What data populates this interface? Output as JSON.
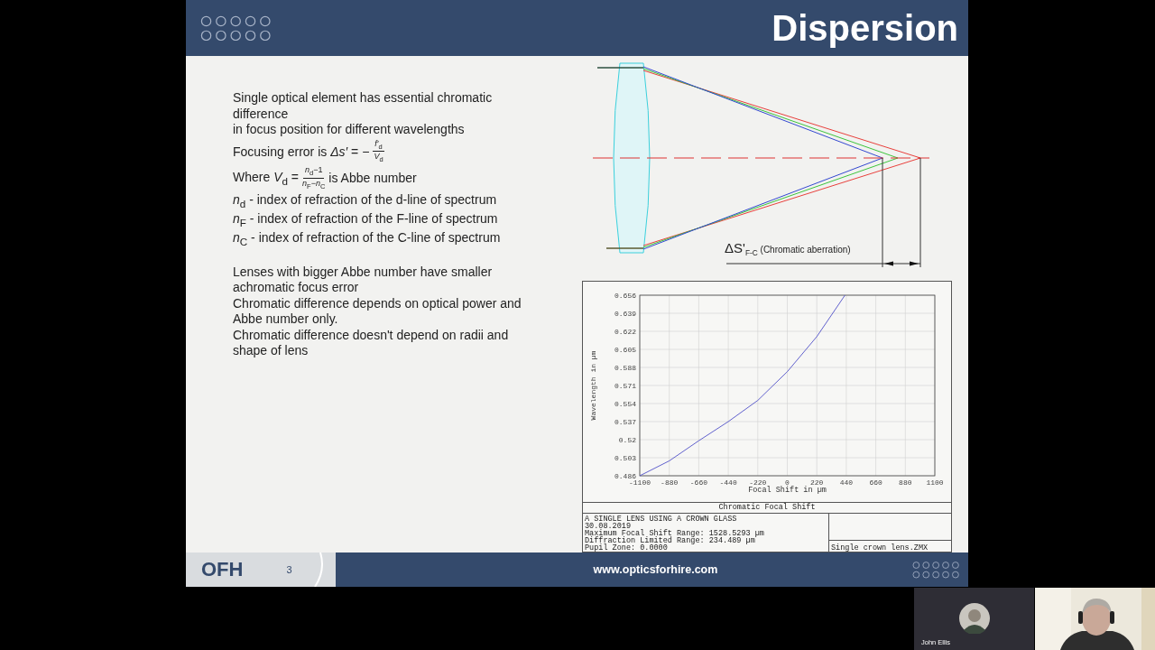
{
  "slide": {
    "title": "Dispersion",
    "body": [
      {
        "kind": "text",
        "text": "Single optical element has essential chromatic difference"
      },
      {
        "kind": "text",
        "text": "in focus position for different wavelengths"
      },
      {
        "kind": "formula",
        "lead": "Focusing error is *Δs′* = −",
        "numerator": "*f′*$_{d}$",
        "denominator": "*V*$_{d}$"
      },
      {
        "kind": "formula",
        "lead": "Where *V*$_{d}$ =",
        "numerator": "*n*$_{d}$−1",
        "denominator": "*n*$_{F}$−*n*$_{C}$",
        "tail": "is Abbe number"
      },
      {
        "kind": "text",
        "text": "*n*$_{d}$ - index of refraction of the d-line of spectrum"
      },
      {
        "kind": "text",
        "text": "*n*$_{F}$ - index of refraction of the F-line of spectrum"
      },
      {
        "kind": "text",
        "text": "*n*$_{C}$ - index of refraction of the C-line of spectrum"
      },
      {
        "kind": "spacer"
      },
      {
        "kind": "text",
        "text": "Lenses with bigger Abbe number have smaller achromatic focus error"
      },
      {
        "kind": "text",
        "text": "Chromatic difference depends on optical power and Abbe number only."
      },
      {
        "kind": "text",
        "text": "Chromatic difference doesn't depend on radii and shape of lens"
      }
    ],
    "diagram": {
      "symbol": "ΔS'",
      "subscript": "F-C",
      "note": "(Chromatic aberration)"
    },
    "plot": {
      "chart_data": {
        "type": "line",
        "xlabel": "Focal Shift in µm",
        "ylabel": "Wavelength in µm",
        "x": [
          -1100,
          -880,
          -660,
          -440,
          -220,
          0,
          220,
          430
        ],
        "values": [
          0.486,
          0.5,
          0.519,
          0.537,
          0.557,
          0.584,
          0.617,
          0.656
        ],
        "grid": true,
        "xlim": [
          -1100,
          1100
        ],
        "ylim": [
          0.486,
          0.656
        ],
        "xticks": [
          -1100,
          -880,
          -660,
          -440,
          -220,
          0,
          220,
          440,
          660,
          880,
          1100
        ],
        "yticks": [
          0.486,
          0.503,
          0.52,
          0.537,
          0.554,
          0.571,
          0.588,
          0.605,
          0.622,
          0.639,
          0.656
        ]
      },
      "caption": "Chromatic Focal Shift",
      "info": [
        "A SINGLE LENS USING A CROWN GLASS",
        "30.08.2019",
        "Maximum Focal Shift Range: 1528.5293 µm",
        "Diffraction Limited Range: 234.489 µm",
        "Pupil Zone: 0.0000"
      ],
      "file": "Single crown lens.ZMX"
    },
    "footer": {
      "logo": "OFH",
      "page": "3",
      "url": "www.opticsforhire.com"
    }
  },
  "call": {
    "participants": [
      {
        "kind": "avatar",
        "name": "John Ellis"
      },
      {
        "kind": "video"
      }
    ]
  }
}
